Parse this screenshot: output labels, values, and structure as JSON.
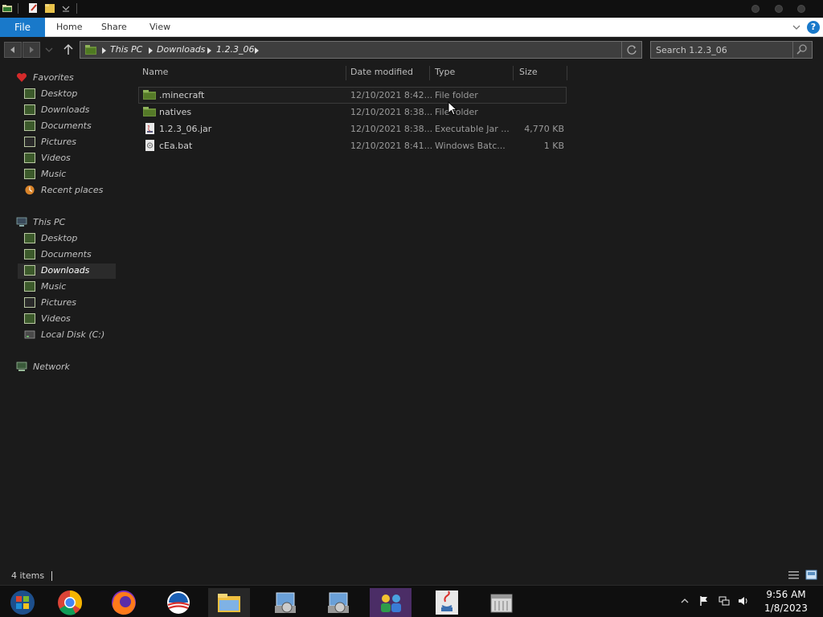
{
  "ribbon": {
    "file_tab": "File",
    "tabs": [
      "Home",
      "Share",
      "View"
    ]
  },
  "address_bar": {
    "crumbs": [
      "This PC",
      "Downloads",
      "1.2.3_06"
    ]
  },
  "search": {
    "placeholder": "Search 1.2.3_06"
  },
  "nav_pane": {
    "favorites_header": "Favorites",
    "favorites": [
      "Desktop",
      "Downloads",
      "Documents",
      "Pictures",
      "Videos",
      "Music",
      "Recent places"
    ],
    "thispc_header": "This PC",
    "thispc_items": [
      "Desktop",
      "Documents",
      "Downloads",
      "Music",
      "Pictures",
      "Videos",
      "Local Disk (C:)"
    ],
    "network": "Network",
    "selected": "Downloads"
  },
  "file_list": {
    "columns": [
      "Name",
      "Date modified",
      "Type",
      "Size"
    ],
    "rows": [
      {
        "name": ".minecraft",
        "date": "12/10/2021 8:42...",
        "type": "File folder",
        "size": "",
        "icon": "folder-icon"
      },
      {
        "name": "natives",
        "date": "12/10/2021 8:38...",
        "type": "File folder",
        "size": "",
        "icon": "folder-icon"
      },
      {
        "name": "1.2.3_06.jar",
        "date": "12/10/2021 8:38...",
        "type": "Executable Jar ...",
        "size": "4,770 KB",
        "icon": "jar-file-icon"
      },
      {
        "name": "cEa.bat",
        "date": "12/10/2021 8:41...",
        "type": "Windows Batc...",
        "size": "1 KB",
        "icon": "batch-file-icon"
      }
    ]
  },
  "status_bar": {
    "item_count": "4 items"
  },
  "taskbar": {
    "apps": [
      "start-orb",
      "chrome",
      "firefox",
      "obama-logo-app",
      "file-explorer",
      "installer-1",
      "installer-2",
      "people-app",
      "java",
      "archive-app"
    ],
    "time": "9:56 AM",
    "date": "1/8/2023"
  },
  "colors": {
    "file_tab": "#1979ca",
    "background": "#1b1b1b",
    "taskbar": "#0f0f0f"
  }
}
